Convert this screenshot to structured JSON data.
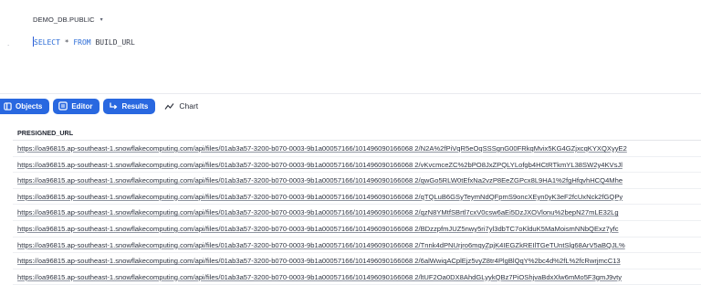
{
  "context": {
    "database_schema": "DEMO_DB.PUBLIC",
    "chevron": "▾"
  },
  "gutter": {
    "mark": "."
  },
  "editor": {
    "tokens": [
      {
        "text": "SELECT",
        "kind": "kw"
      },
      {
        "text": " * ",
        "kind": "op"
      },
      {
        "text": "FROM",
        "kind": "kw"
      },
      {
        "text": " BUILD_URL",
        "kind": "id"
      }
    ]
  },
  "toolbar": {
    "objects_label": "Objects",
    "editor_label": "Editor",
    "results_label": "Results",
    "chart_label": "Chart",
    "accent_color": "#2968e0"
  },
  "results": {
    "columns": [
      "PRESIGNED_URL"
    ],
    "rows": [
      "https://oa96815.ap-southeast-1.snowflakecomputing.com/api/files/01ab3a57-3200-b070-0003-9b1a00057166/101496090166068 2/N2A%2fPiVqR5eOqSSSgnG00FRkqMvix5KG4GZjxcqKYXQXyyE2",
      "https://oa96815.ap-southeast-1.snowflakecomputing.com/api/files/01ab3a57-3200-b070-0003-9b1a00057166/101496090166068 2/vKvcmceZC%2bPO8JxZPQLYLofgb4HCtRTkmYL38SW2y4KVsJl",
      "https://oa96815.ap-southeast-1.snowflakecomputing.com/api/files/01ab3a57-3200-b070-0003-9b1a00057166/101496090166068 2/qwGo5RLW0tEfxNa2vzP8EeZGPcx8L9HA1%2fgHfqvhHCQ4Mhe",
      "https://oa96815.ap-southeast-1.snowflakecomputing.com/api/files/01ab3a57-3200-b070-0003-9b1a00057166/101496090166068 2/qTQLuB6GSyTeymNdQFpmS9oncXEyn0yK3eF2fcUxNck2fGQPy",
      "https://oa96815.ap-southeast-1.snowflakecomputing.com/api/files/01ab3a57-3200-b070-0003-9b1a00057166/101496090166068 2/qzN8YMtfSBrtl7cxV0csw6aEi5DzJXOVlonu%2bepN27mLE32Lg",
      "https://oa96815.ap-southeast-1.snowflakecomputing.com/api/files/01ab3a57-3200-b070-0003-9b1a00057166/101496090166068 2/BDzzpfmJUZ5nwy5ri7yl3dbTC7oKlduK5MaMoismNNbQExz7yfc",
      "https://oa96815.ap-southeast-1.snowflakecomputing.com/api/files/01ab3a57-3200-b070-0003-9b1a00057166/101496090166068 2/Tnnk4dPNUrjro6mqyZpjK4IEGZkREIlTGeTUntSlg68ArV5aBQJL%",
      "https://oa96815.ap-southeast-1.snowflakecomputing.com/api/files/01ab3a57-3200-b070-0003-9b1a00057166/101496090166068 2/6alWwiqACplEjz5vyZ8tr4PlgBlQqY%2bc4d%2fL%2fcRwrjmcC13",
      "https://oa96815.ap-southeast-1.snowflakecomputing.com/api/files/01ab3a57-3200-b070-0003-9b1a00057166/101496090166068 2/ltUF2Oa0DX8AhdGLyykQBz7PiOShjvaBdxXlw6mMo5F3gmJ9vty"
    ]
  }
}
